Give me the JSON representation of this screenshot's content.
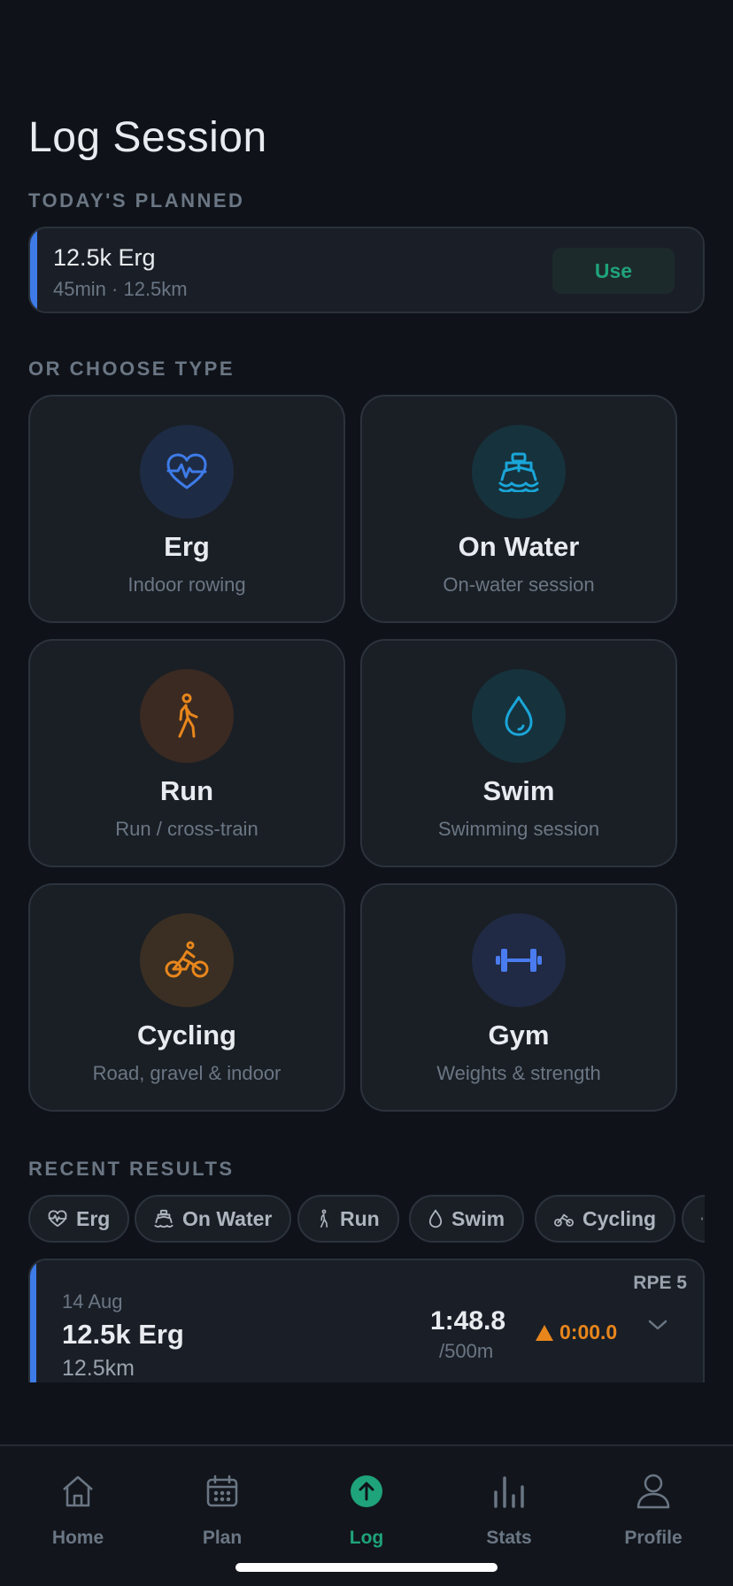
{
  "page": {
    "title": "Log Session"
  },
  "planned": {
    "section_label": "TODAY'S PLANNED",
    "title": "12.5k Erg",
    "subtitle": "45min · 12.5km",
    "use_label": "Use"
  },
  "types": {
    "section_label": "OR CHOOSE TYPE",
    "items": [
      {
        "name": "Erg",
        "desc": "Indoor rowing",
        "icon": "heart-pulse-icon",
        "color": "#3e7be8"
      },
      {
        "name": "On Water",
        "desc": "On-water session",
        "icon": "boat-icon",
        "color": "#1aa6d9"
      },
      {
        "name": "Run",
        "desc": "Run / cross-train",
        "icon": "walking-person-icon",
        "color": "#e8861c"
      },
      {
        "name": "Swim",
        "desc": "Swimming session",
        "icon": "water-drop-icon",
        "color": "#1aa6d9"
      },
      {
        "name": "Cycling",
        "desc": "Road, gravel & indoor",
        "icon": "bicycle-icon",
        "color": "#e8861c"
      },
      {
        "name": "Gym",
        "desc": "Weights & strength",
        "icon": "dumbbell-icon",
        "color": "#4a7cf0"
      }
    ]
  },
  "recent": {
    "section_label": "RECENT RESULTS",
    "filters": [
      "Erg",
      "On Water",
      "Run",
      "Swim",
      "Cycling"
    ],
    "result": {
      "date": "14 Aug",
      "title": "12.5k Erg",
      "distance": "12.5km",
      "rpe": "RPE 5",
      "split": "1:48.8",
      "split_unit": "/500m",
      "delta": "0:00.0"
    }
  },
  "nav": {
    "items": [
      {
        "label": "Home",
        "icon": "home-icon"
      },
      {
        "label": "Plan",
        "icon": "calendar-icon"
      },
      {
        "label": "Log",
        "icon": "upload-circle-icon"
      },
      {
        "label": "Stats",
        "icon": "bar-chart-icon"
      },
      {
        "label": "Profile",
        "icon": "person-icon"
      }
    ],
    "active": "Log"
  },
  "colors": {
    "accent_green": "#1fa37a",
    "accent_blue": "#3e7be8",
    "accent_orange": "#e8861c"
  }
}
